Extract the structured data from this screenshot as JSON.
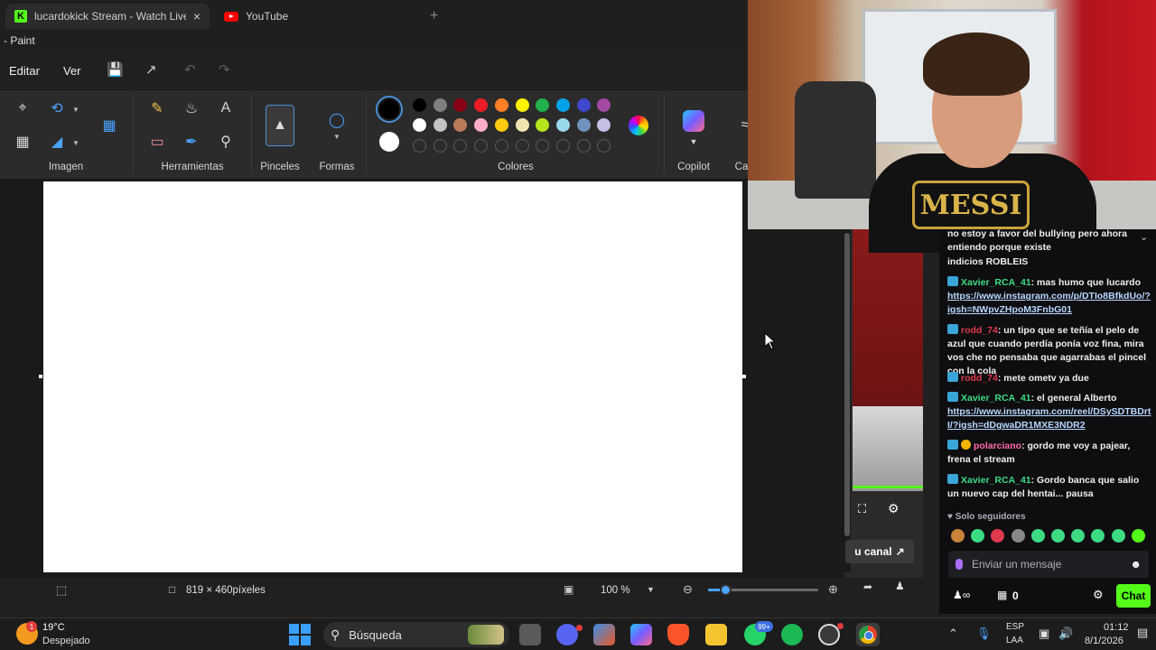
{
  "browser": {
    "tabs": [
      {
        "title": "lucardokick Stream - Watch Live",
        "favicon": "kick-icon"
      },
      {
        "title": "YouTube",
        "favicon": "youtube-icon"
      }
    ],
    "new_tab_glyph": "+",
    "close_glyph": "×"
  },
  "paint": {
    "window_title": "- Paint",
    "menu": {
      "edit": "Editar",
      "view": "Ver"
    },
    "groups": {
      "image": "Imagen",
      "tools": "Herramientas",
      "brushes": "Pinceles",
      "shapes": "Formas",
      "colors": "Colores",
      "copilot": "Copilot",
      "layers_partial": "Ca"
    },
    "palette_row1": [
      "#000000",
      "#7f7f7f",
      "#880015",
      "#ed1c24",
      "#ff7f27",
      "#fff200",
      "#22b14c",
      "#00a2e8",
      "#3f48cc",
      "#a349a4"
    ],
    "palette_row2": [
      "#ffffff",
      "#c3c3c3",
      "#b97a57",
      "#ffaec9",
      "#ffc90e",
      "#efe4b0",
      "#b5e61d",
      "#99d9ea",
      "#7092be",
      "#c8bfe7"
    ],
    "color1": "#000000",
    "color2": "#ffffff",
    "status": {
      "canvas_size": "819 × 460píxeles",
      "zoom": "100 %",
      "zoom_percent": 100
    }
  },
  "stream": {
    "your_channel": "u canal",
    "followers_only": "Solo seguidores",
    "input_placeholder": "Enviar un mensaje",
    "chat_button": "Chat",
    "viewer_count": "0",
    "messages": [
      {
        "user": "",
        "text": "no estoy a favor del bullying pero ahora entiendo porque existe"
      },
      {
        "user": "",
        "text": "indicios ROBLEIS"
      },
      {
        "user": "Xavier_RCA_41",
        "text": ": mas humo que lucardo",
        "link": "https://www.instagram.com/p/DTIo8BfkdUo/?igsh=NWpvZHpoM3FnbG01"
      },
      {
        "user": "rodd_74",
        "text": ": un tipo que se teñía el pelo de azul que cuando perdía ponía voz fina, mira vos che no pensaba que agarrabas el pincel con la cola"
      },
      {
        "user": "rodd_74",
        "text": ": mete ometv ya due"
      },
      {
        "user": "Xavier_RCA_41",
        "text": ": el general Alberto",
        "link": "https://www.instagram.com/reel/DSySDTBDrtI/?igsh=dDgwaDR1MXE3NDR2"
      },
      {
        "user": "polarciano",
        "text": ": gordo me voy a pajear, frena el stream"
      },
      {
        "user": "Xavier_RCA_41",
        "text": ": Gordo banca que salio un nuevo cap del hentai... pausa"
      }
    ],
    "webcam_shirt_text": "MESSI"
  },
  "taskbar": {
    "temperature": "19°C",
    "weather": "Despejado",
    "weather_badge": "1",
    "search": "Búsqueda",
    "whatsapp_badge": "99+",
    "lang_top": "ESP",
    "lang_bottom": "LAA",
    "time": "01:12",
    "date": "8/1/2026"
  }
}
